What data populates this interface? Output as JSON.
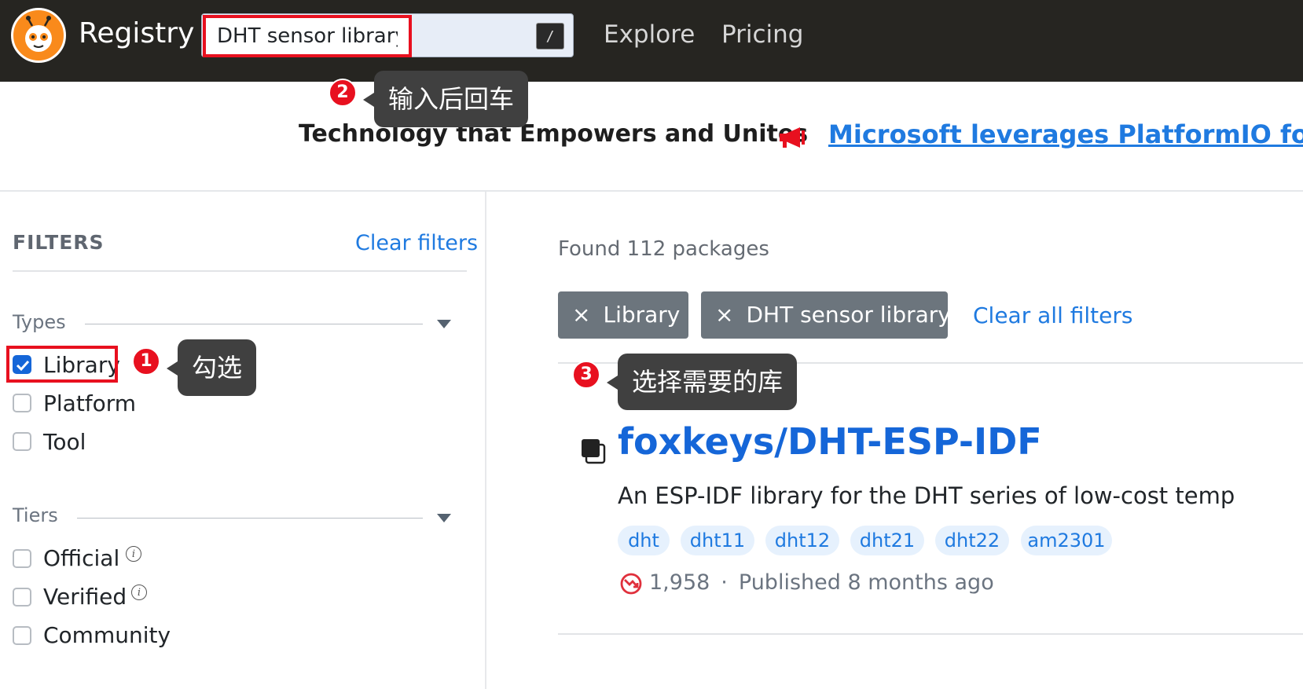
{
  "header": {
    "brand": "Registry",
    "search_value": "DHT sensor library",
    "search_shortcut": "/",
    "nav": [
      "Explore",
      "Pricing"
    ]
  },
  "banner": {
    "text": "Technology that Empowers and Unites",
    "link": "Microsoft leverages PlatformIO fo"
  },
  "sidebar": {
    "title": "FILTERS",
    "clear": "Clear filters",
    "types": {
      "title": "Types",
      "items": [
        {
          "label": "Library",
          "checked": true
        },
        {
          "label": "Platform",
          "checked": false
        },
        {
          "label": "Tool",
          "checked": false
        }
      ]
    },
    "tiers": {
      "title": "Tiers",
      "items": [
        {
          "label": "Official",
          "checked": false
        },
        {
          "label": "Verified",
          "checked": false
        },
        {
          "label": "Community",
          "checked": false
        }
      ],
      "info_glyph": "i"
    }
  },
  "results": {
    "found": "Found 112 packages",
    "chips": [
      "Library",
      "DHT sensor library"
    ],
    "chip_close_glyph": "×",
    "clear_all": "Clear all filters",
    "package": {
      "title": "foxkeys/DHT-ESP-IDF",
      "description": "An ESP-IDF library for the DHT series of low-cost temp",
      "tags": [
        "dht",
        "dht11",
        "dht12",
        "dht21",
        "dht22",
        "am2301"
      ],
      "downloads": "1,958",
      "separator": "·",
      "published": "Published 8 months ago"
    }
  },
  "annotations": [
    {
      "number": "1",
      "text": "勾选"
    },
    {
      "number": "2",
      "text": "输入后回车"
    },
    {
      "number": "3",
      "text": "选择需要的库"
    }
  ],
  "colors": {
    "accent": "#1f7ae0",
    "highlight": "#e8101f",
    "topbar": "#262521",
    "logo": "#f98a1b"
  }
}
